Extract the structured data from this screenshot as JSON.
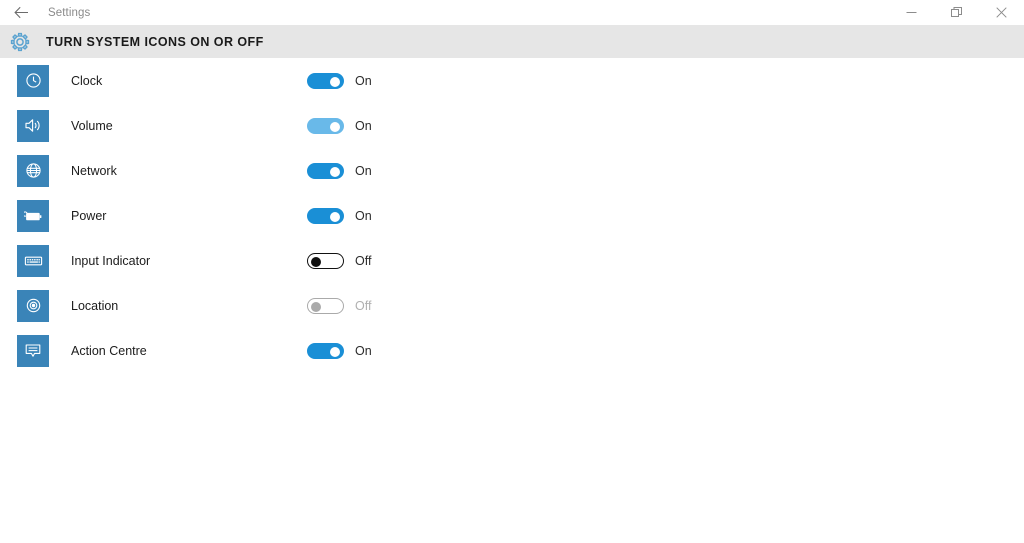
{
  "titlebar": {
    "back_icon": "back-arrow-icon",
    "app_title": "Settings",
    "controls": {
      "minimize": "minimize-icon",
      "maximize": "restore-icon",
      "close": "close-icon"
    }
  },
  "header": {
    "gear_icon": "gear-icon",
    "page_title": "TURN SYSTEM ICONS ON OR OFF"
  },
  "colors": {
    "tile_blue": "#3a84b8",
    "toggle_on": "#1a8fd6",
    "toggle_on_hover": "#69b9e9",
    "header_band": "#e6e6e6",
    "gear_blue": "#5ba3d0"
  },
  "rows": [
    {
      "icon": "clock-icon",
      "label": "Clock",
      "state": "On",
      "toggle": "on"
    },
    {
      "icon": "volume-icon",
      "label": "Volume",
      "state": "On",
      "toggle": "on-hover"
    },
    {
      "icon": "network-globe-icon",
      "label": "Network",
      "state": "On",
      "toggle": "on"
    },
    {
      "icon": "battery-icon",
      "label": "Power",
      "state": "On",
      "toggle": "on"
    },
    {
      "icon": "keyboard-icon",
      "label": "Input Indicator",
      "state": "Off",
      "toggle": "off"
    },
    {
      "icon": "location-icon",
      "label": "Location",
      "state": "Off",
      "toggle": "disabled"
    },
    {
      "icon": "action-centre-icon",
      "label": "Action Centre",
      "state": "On",
      "toggle": "on"
    }
  ]
}
